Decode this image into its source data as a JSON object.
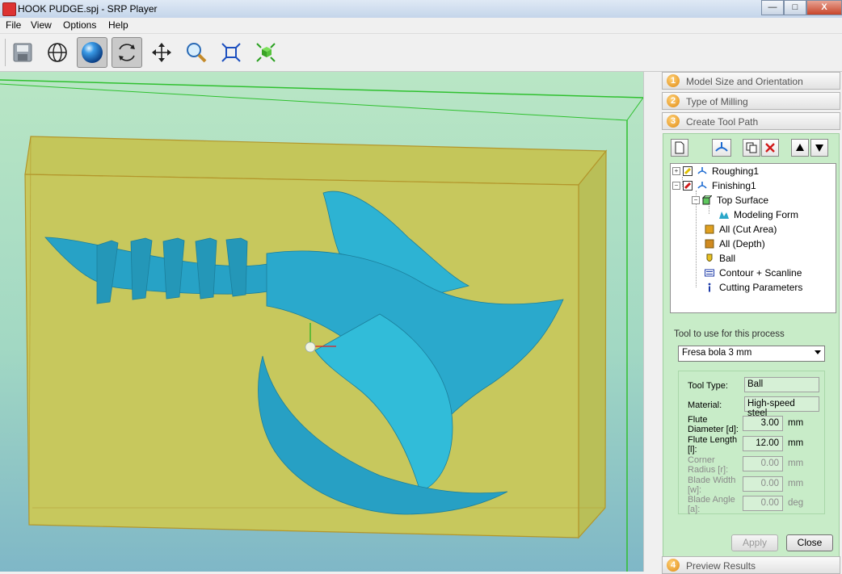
{
  "window": {
    "title": "HOOK PUDGE.spj - SRP Player",
    "min": "—",
    "max": "□",
    "close": "X"
  },
  "menu": [
    "File",
    "View",
    "Options",
    "Help"
  ],
  "toolbar": {
    "buttons": [
      "save-icon",
      "globe-icon",
      "sphere-icon",
      "rotate-icon",
      "move-icon",
      "zoom-icon",
      "fit-icon",
      "origin-icon"
    ],
    "active": [
      "sphere-icon",
      "rotate-icon"
    ]
  },
  "steps": [
    {
      "num": "1",
      "label": "Model Size and Orientation"
    },
    {
      "num": "2",
      "label": "Type of Milling"
    },
    {
      "num": "3",
      "label": "Create Tool Path"
    },
    {
      "num": "4",
      "label": "Preview Results"
    }
  ],
  "toolpath_buttons": [
    "new-process-icon",
    "tool-path-icon",
    "copy-icon",
    "delete-icon",
    "move-up-icon",
    "move-down-icon"
  ],
  "tree": [
    {
      "label": "Roughing1",
      "icon": "process-icon",
      "checked": true
    },
    {
      "label": "Finishing1",
      "icon": "process-icon",
      "checked": true
    },
    {
      "label": "Top Surface",
      "icon": "surface-icon"
    },
    {
      "label": "Modeling Form",
      "icon": "form-icon"
    },
    {
      "label": "All (Cut Area)",
      "icon": "area-icon"
    },
    {
      "label": "All (Depth)",
      "icon": "depth-icon"
    },
    {
      "label": "Ball",
      "icon": "tool-icon"
    },
    {
      "label": "Contour + Scanline",
      "icon": "contour-icon"
    },
    {
      "label": "Cutting Parameters",
      "icon": "info-icon"
    }
  ],
  "tool": {
    "label": "Tool to use for this process",
    "selected": "Fresa bola 3 mm",
    "props": [
      {
        "label": "Tool Type:",
        "value": "Ball"
      },
      {
        "label": "Material:",
        "value": "High-speed steel"
      },
      {
        "label": "Flute Diameter [d]:",
        "value": "3.00",
        "unit": "mm"
      },
      {
        "label": "Flute Length [l]:",
        "value": "12.00",
        "unit": "mm"
      },
      {
        "label": "Corner Radius [r]:",
        "value": "0.00",
        "unit": "mm",
        "disabled": true
      },
      {
        "label": "Blade Width [w]:",
        "value": "0.00",
        "unit": "mm",
        "disabled": true
      },
      {
        "label": "Blade Angle [a]:",
        "value": "0.00",
        "unit": "deg",
        "disabled": true
      }
    ]
  },
  "buttons": {
    "apply": "Apply",
    "close": "Close"
  },
  "colors": {
    "model": "#2aa7c9",
    "stock": "#c8c85a",
    "viewport_top": "#b9e6c5"
  }
}
